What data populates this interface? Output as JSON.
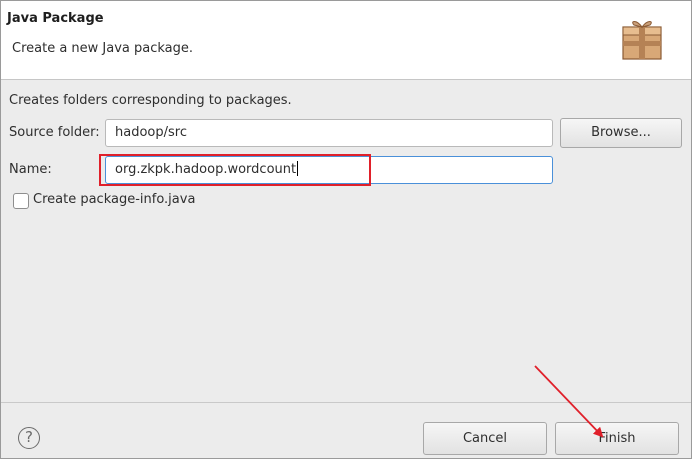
{
  "banner": {
    "title": "Java Package",
    "description": "Create a new Java package."
  },
  "intro_text": "Creates folders corresponding to packages.",
  "form": {
    "source_folder_label": "Source folder:",
    "source_folder_value": "hadoop/src",
    "browse_label": "Browse...",
    "name_label": "Name:",
    "name_value": "org.zkpk.hadoop.wordcount",
    "checkbox_label": "Create package-info.java",
    "checkbox_checked": false
  },
  "footer": {
    "help_glyph": "?",
    "cancel_label": "Cancel",
    "finish_label": "Finish"
  },
  "annotations": {
    "highlight_color": "#e0202a",
    "arrow_color": "#e0202a"
  },
  "icons": {
    "banner_icon": "package-icon",
    "help_icon": "help-icon"
  }
}
